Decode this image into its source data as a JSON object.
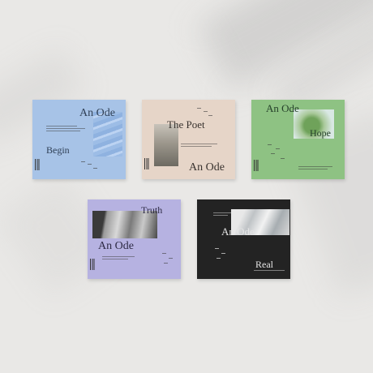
{
  "albums": [
    {
      "title": "An Ode",
      "subtitle": "Begin",
      "color": "#a7c3e7"
    },
    {
      "title": "The Poet",
      "subtitle": "An Ode",
      "color": "#e6d5c8"
    },
    {
      "title": "An Ode",
      "subtitle": "Hope",
      "color": "#8ec283"
    },
    {
      "title": "Truth",
      "subtitle": "An Ode",
      "color": "#b6b2e1"
    },
    {
      "title": "An Ode",
      "subtitle": "Real",
      "color": "#232323"
    }
  ]
}
